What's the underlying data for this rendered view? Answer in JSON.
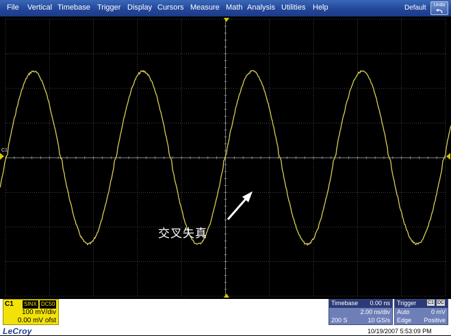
{
  "menu": {
    "items": [
      "File",
      "Vertical",
      "Timebase",
      "Trigger",
      "Display",
      "Cursors",
      "Measure",
      "Math",
      "Analysis",
      "Utilities",
      "Help"
    ],
    "default_label": "Default",
    "undo_label": "Undo"
  },
  "screen": {
    "channel_marker": "C1",
    "annotation": "交叉失真",
    "trace_color": "#d9cf55",
    "grid_color": "#5c5c5c"
  },
  "channel_panel": {
    "name": "C1",
    "tag1": "SINX",
    "tag2": "DC50",
    "vdiv": "100 mV/div",
    "offset": "0.00 mV ofst",
    "color": "#f2e20a"
  },
  "timebase_panel": {
    "title": "Timebase",
    "delay": "0.00 ns",
    "tdiv": "2.00 ns/div",
    "points": "200 S",
    "rate": "10 GS/s"
  },
  "trigger_panel": {
    "title": "Trigger",
    "tag1": "C1",
    "tag2": "DC",
    "mode": "Auto",
    "level": "0 mV",
    "type": "Edge",
    "slope": "Positive"
  },
  "status": {
    "brand": "LeCroy",
    "timestamp": "10/19/2007 5:53:09 PM"
  }
}
